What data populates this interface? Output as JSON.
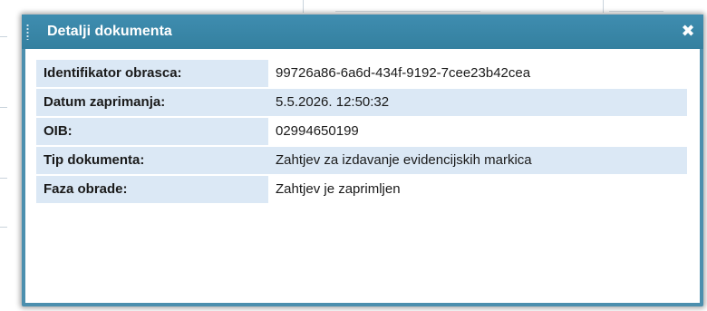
{
  "dialog": {
    "title": "Detalji dokumenta",
    "close_symbol": "✖",
    "close_icon": "close-icon",
    "grip_icon": "drag-grip-icon",
    "colors": {
      "titlebar": "#3a86a8",
      "label_bg": "#dbe8f5"
    },
    "fields": [
      {
        "label": "Identifikator obrasca:",
        "value": "99726a86-6a6d-434f-9192-7cee23b42cea"
      },
      {
        "label": "Datum zaprimanja:",
        "value": "5.5.2026. 12:50:32"
      },
      {
        "label": "OIB:",
        "value": "02994650199"
      },
      {
        "label": "Tip dokumenta:",
        "value": "Zahtjev za izdavanje evidencijskih markica"
      },
      {
        "label": "Faza obrade:",
        "value": "Zahtjev je zaprimljen"
      }
    ]
  }
}
